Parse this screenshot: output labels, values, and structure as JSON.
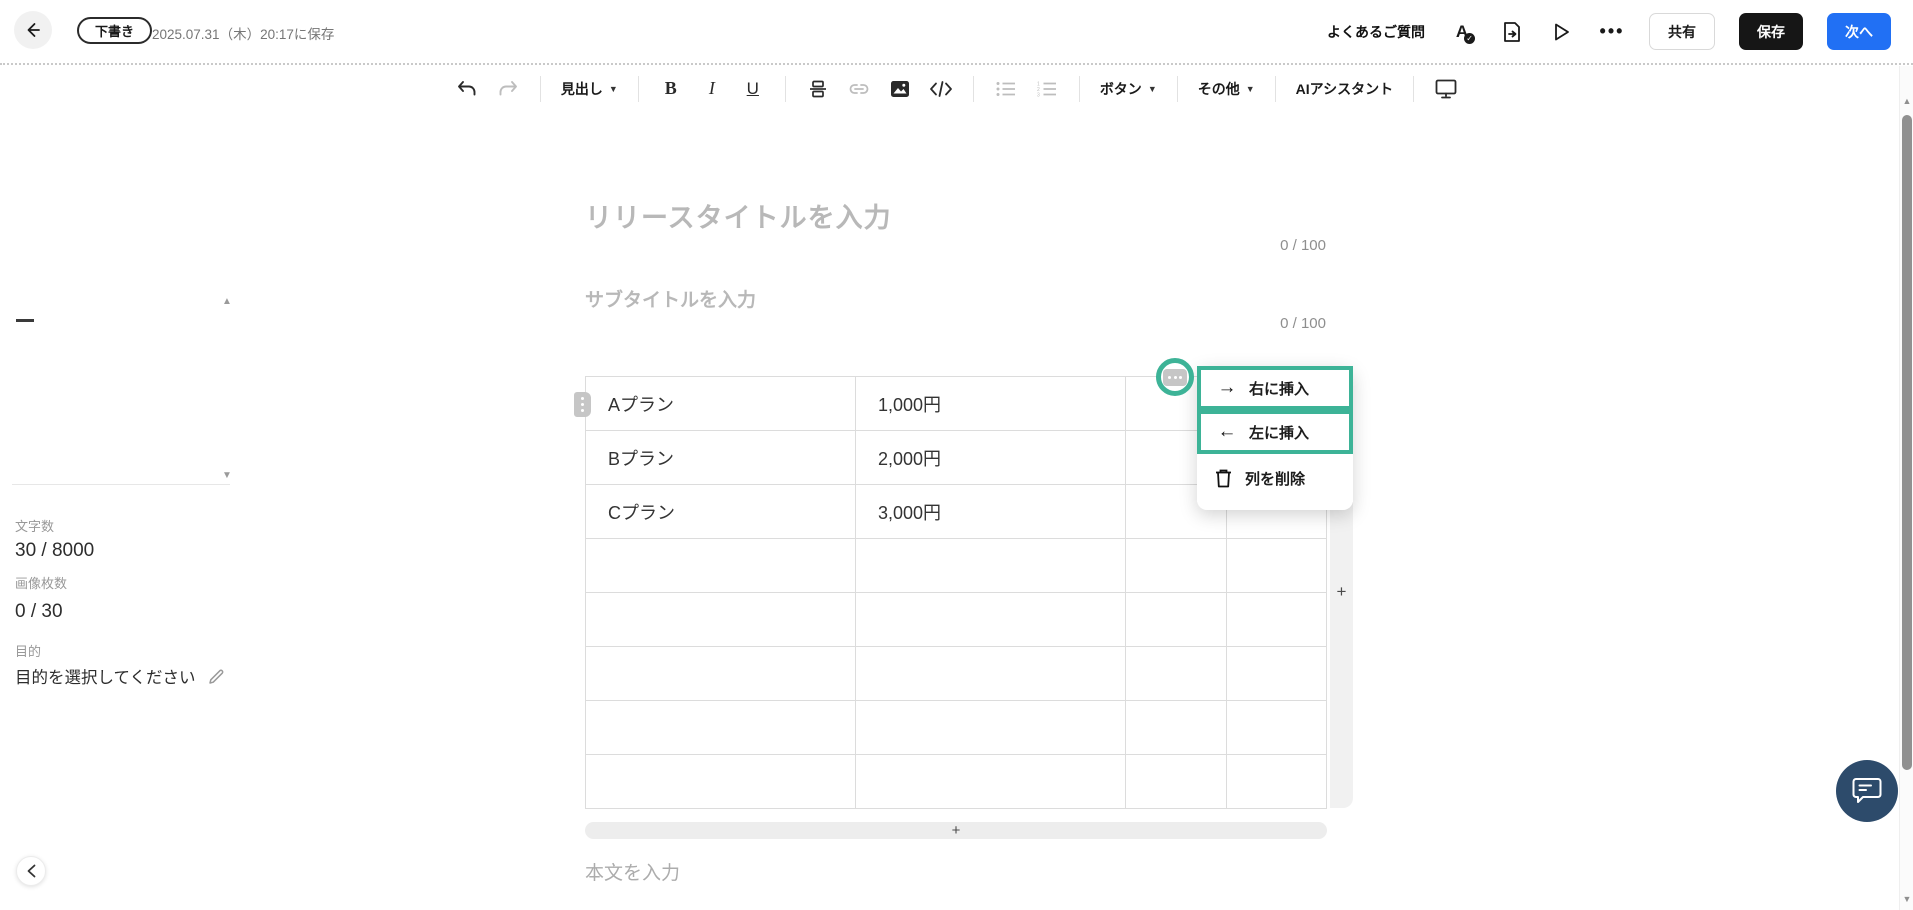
{
  "header": {
    "status_badge": "下書き",
    "saved_at": "2025.07.31（木）20:17に保存",
    "faq_link": "よくあるご質問",
    "share_button": "共有",
    "save_button": "保存",
    "next_button": "次へ"
  },
  "toolbar": {
    "heading_label": "見出し",
    "bold_label": "B",
    "italic_label": "I",
    "underline_label": "U",
    "button_label": "ボタン",
    "others_label": "その他",
    "ai_assistant_label": "AIアシスタント"
  },
  "sidebar": {
    "char_count_label": "文字数",
    "char_count_value": "30 / 8000",
    "image_count_label": "画像枚数",
    "image_count_value": "0 / 30",
    "purpose_label": "目的",
    "purpose_value": "目的を選択してください"
  },
  "editor": {
    "title_placeholder": "リリースタイトルを入力",
    "title_counter": "0 / 100",
    "subtitle_placeholder": "サブタイトルを入力",
    "subtitle_counter": "0 / 100",
    "body_placeholder": "本文を入力",
    "add_row_label": "+",
    "add_column_label": "+"
  },
  "table": {
    "rows": [
      {
        "cells": [
          "Aプラン",
          "1,000円",
          "",
          ""
        ]
      },
      {
        "cells": [
          "Bプラン",
          "2,000円",
          "",
          ""
        ]
      },
      {
        "cells": [
          "Cプラン",
          "3,000円",
          "",
          ""
        ]
      },
      {
        "cells": [
          "",
          "",
          "",
          ""
        ]
      },
      {
        "cells": [
          "",
          "",
          "",
          ""
        ]
      },
      {
        "cells": [
          "",
          "",
          "",
          ""
        ]
      },
      {
        "cells": [
          "",
          "",
          "",
          ""
        ]
      },
      {
        "cells": [
          "",
          "",
          "",
          ""
        ]
      }
    ]
  },
  "context_menu": {
    "insert_right": "右に挿入",
    "insert_left": "左に挿入",
    "delete_column": "列を削除"
  },
  "colors": {
    "accent_teal": "#3db397",
    "primary_blue": "#2170f4",
    "save_black": "#161616",
    "chat_navy": "#2d4b6b"
  }
}
